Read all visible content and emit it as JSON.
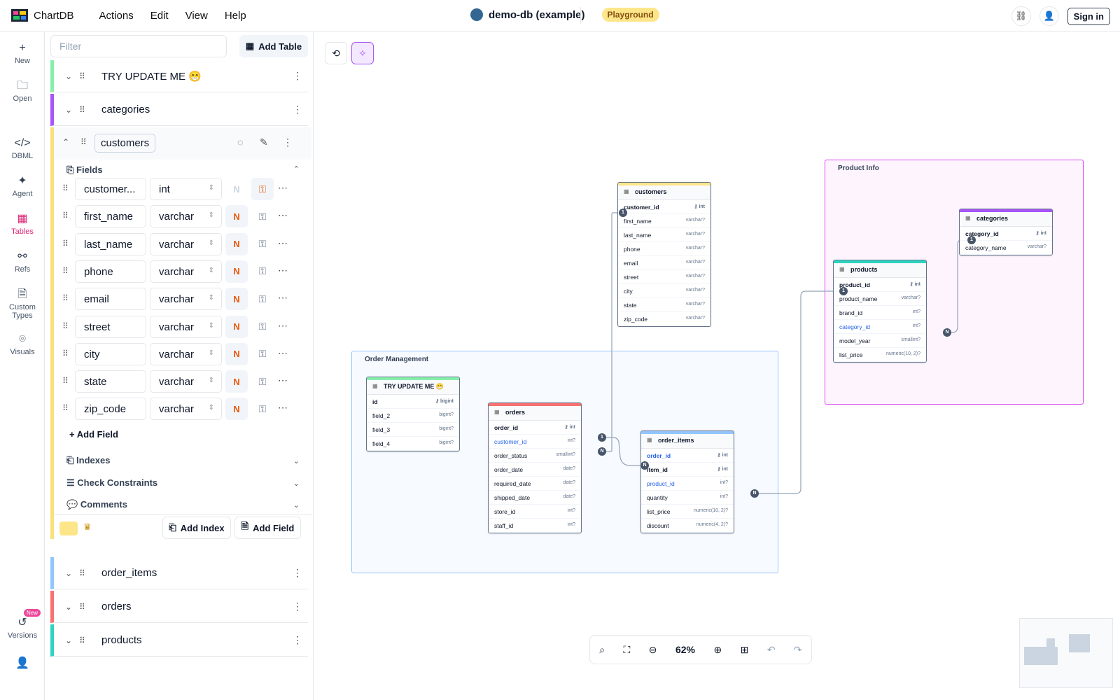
{
  "app": {
    "name": "ChartDB",
    "menu": [
      "Actions",
      "Edit",
      "View",
      "Help"
    ]
  },
  "diagram": {
    "title": "demo-db (example)",
    "badge": "Playground"
  },
  "topbar": {
    "sign_in": "Sign in"
  },
  "rail": [
    {
      "label": "New",
      "icon": "plus-icon"
    },
    {
      "label": "Open",
      "icon": "folder-icon"
    },
    {
      "label": "DBML",
      "icon": "code-icon"
    },
    {
      "label": "Agent",
      "icon": "wand-icon"
    },
    {
      "label": "Tables",
      "icon": "table-icon",
      "active": true
    },
    {
      "label": "Refs",
      "icon": "refs-icon"
    },
    {
      "label": "Custom Types",
      "icon": "file-icon"
    },
    {
      "label": "Visuals",
      "icon": "visuals-icon"
    },
    {
      "label": "Versions",
      "icon": "history-icon",
      "badge": "New"
    }
  ],
  "sidebar": {
    "filter_placeholder": "Filter",
    "add_table": "Add Table",
    "tables_above": [
      {
        "name": "TRY UPDATE ME 😁",
        "color": "#86efac"
      },
      {
        "name": "categories",
        "color": "#a855f7"
      }
    ],
    "expanded": {
      "name": "customers",
      "color": "#fde68a",
      "fields_label": "Fields",
      "fields": [
        {
          "name": "customer...",
          "type": "int",
          "nullable": "N",
          "nullable_on": false,
          "pk": true
        },
        {
          "name": "first_name",
          "type": "varchar",
          "nullable": "N",
          "nullable_on": true,
          "pk": false
        },
        {
          "name": "last_name",
          "type": "varchar",
          "nullable": "N",
          "nullable_on": true,
          "pk": false
        },
        {
          "name": "phone",
          "type": "varchar",
          "nullable": "N",
          "nullable_on": true,
          "pk": false
        },
        {
          "name": "email",
          "type": "varchar",
          "nullable": "N",
          "nullable_on": true,
          "pk": false
        },
        {
          "name": "street",
          "type": "varchar",
          "nullable": "N",
          "nullable_on": true,
          "pk": false
        },
        {
          "name": "city",
          "type": "varchar",
          "nullable": "N",
          "nullable_on": true,
          "pk": false
        },
        {
          "name": "state",
          "type": "varchar",
          "nullable": "N",
          "nullable_on": true,
          "pk": false
        },
        {
          "name": "zip_code",
          "type": "varchar",
          "nullable": "N",
          "nullable_on": true,
          "pk": false
        }
      ],
      "add_field": "Add Field",
      "indexes": "Indexes",
      "check_constraints": "Check Constraints",
      "comments": "Comments",
      "add_index_button": "Add Index",
      "add_field_button": "Add Field"
    },
    "tables_below": [
      {
        "name": "order_items",
        "color": "#93c5fd"
      },
      {
        "name": "orders",
        "color": "#f87171"
      },
      {
        "name": "products",
        "color": "#2dd4bf"
      }
    ]
  },
  "canvas": {
    "areas": [
      {
        "label": "Product Info",
        "color": "#d946ef"
      },
      {
        "label": "Order Management",
        "color": "#93c5fd"
      }
    ],
    "tables": {
      "customers": {
        "name": "customers",
        "color": "#fde68a",
        "fields": [
          {
            "n": "customer_id",
            "t": "int",
            "pk": true
          },
          {
            "n": "first_name",
            "t": "varchar?"
          },
          {
            "n": "last_name",
            "t": "varchar?"
          },
          {
            "n": "phone",
            "t": "varchar?"
          },
          {
            "n": "email",
            "t": "varchar?"
          },
          {
            "n": "street",
            "t": "varchar?"
          },
          {
            "n": "city",
            "t": "varchar?"
          },
          {
            "n": "state",
            "t": "varchar?"
          },
          {
            "n": "zip_code",
            "t": "varchar?"
          }
        ]
      },
      "categories": {
        "name": "categories",
        "color": "#a855f7",
        "fields": [
          {
            "n": "category_id",
            "t": "int",
            "pk": true
          },
          {
            "n": "category_name",
            "t": "varchar?"
          }
        ]
      },
      "products": {
        "name": "products",
        "color": "#2dd4bf",
        "fields": [
          {
            "n": "product_id",
            "t": "int",
            "pk": true
          },
          {
            "n": "product_name",
            "t": "varchar?"
          },
          {
            "n": "brand_id",
            "t": "int?"
          },
          {
            "n": "category_id",
            "t": "int?",
            "fk": true
          },
          {
            "n": "model_year",
            "t": "smallint?"
          },
          {
            "n": "list_price",
            "t": "numeric(10, 2)?"
          }
        ]
      },
      "try": {
        "name": "TRY UPDATE ME 😁",
        "color": "#86efac",
        "fields": [
          {
            "n": "id",
            "t": "bigint",
            "pk": true
          },
          {
            "n": "field_2",
            "t": "bigint?"
          },
          {
            "n": "field_3",
            "t": "bigint?"
          },
          {
            "n": "field_4",
            "t": "bigint?"
          }
        ]
      },
      "orders": {
        "name": "orders",
        "color": "#f87171",
        "fields": [
          {
            "n": "order_id",
            "t": "int",
            "pk": true
          },
          {
            "n": "customer_id",
            "t": "int?",
            "fk": true
          },
          {
            "n": "order_status",
            "t": "smallint?"
          },
          {
            "n": "order_date",
            "t": "date?"
          },
          {
            "n": "required_date",
            "t": "date?"
          },
          {
            "n": "shipped_date",
            "t": "date?"
          },
          {
            "n": "store_id",
            "t": "int?"
          },
          {
            "n": "staff_id",
            "t": "int?"
          }
        ]
      },
      "order_items": {
        "name": "order_items",
        "color": "#93c5fd",
        "fields": [
          {
            "n": "order_id",
            "t": "int",
            "pk": true,
            "fk": true
          },
          {
            "n": "item_id",
            "t": "int",
            "pk": true
          },
          {
            "n": "product_id",
            "t": "int?",
            "fk": true
          },
          {
            "n": "quantity",
            "t": "int?"
          },
          {
            "n": "list_price",
            "t": "numeric(10, 2)?"
          },
          {
            "n": "discount",
            "t": "numeric(4, 2)?"
          }
        ]
      }
    },
    "zoom": "62%"
  }
}
